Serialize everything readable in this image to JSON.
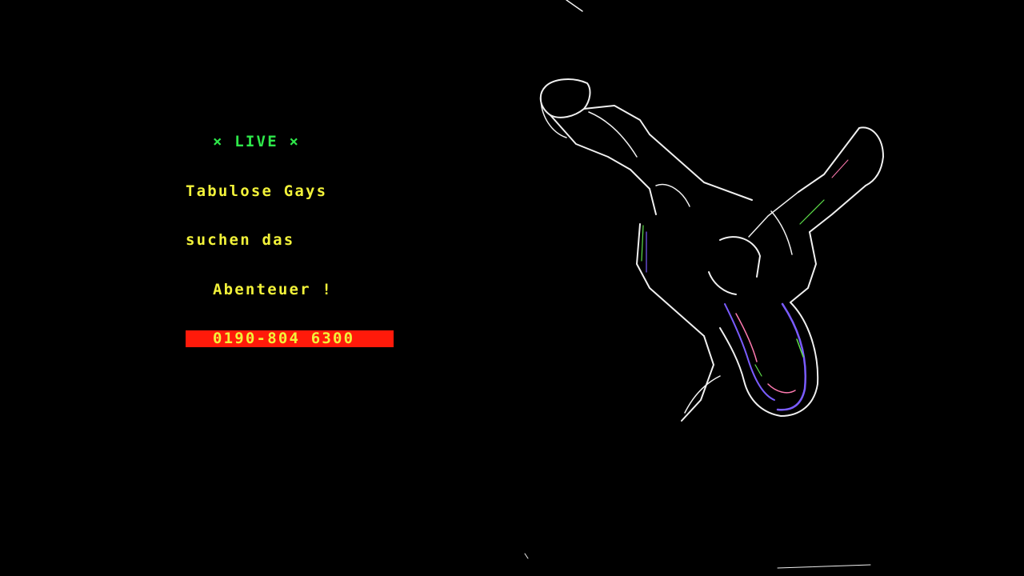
{
  "teletext_ad": {
    "live_marker": "×",
    "live_label": "LIVE",
    "line1": "Tabulose Gays",
    "line2": "suchen das",
    "line3": "Abenteuer !",
    "phone": "0190-804 6300",
    "colors": {
      "marker_green": "#2ee84a",
      "text_yellow": "#f2f23a",
      "phone_bg_red": "#ff1a0a",
      "background": "#000000"
    }
  },
  "graphic": {
    "icon": "edge-filtered-bottle-and-hand-image",
    "colors": {
      "outline_white": "#f0f0f0",
      "tint_violet": "#7a5cff",
      "tint_green": "#5ee04a",
      "tint_pink": "#ff7ab0"
    }
  }
}
